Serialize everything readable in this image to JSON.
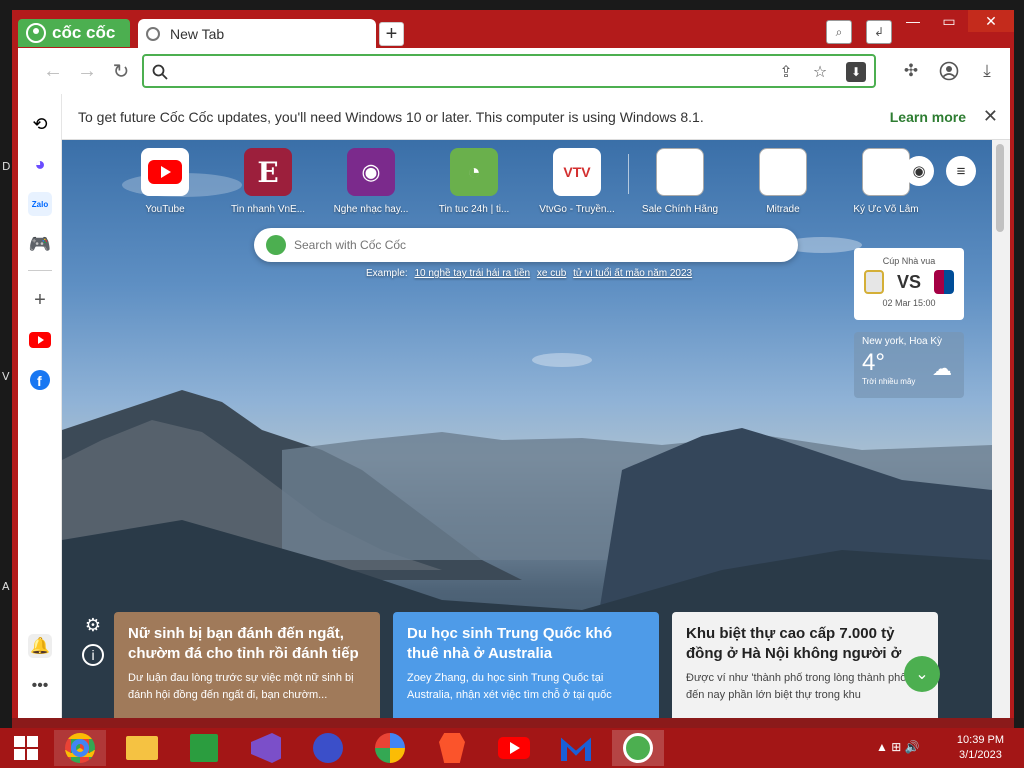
{
  "desktop": {
    "letters": [
      "D",
      "V",
      "A"
    ]
  },
  "browser": {
    "brand": "cốc cốc",
    "tab": {
      "title": "New Tab"
    },
    "newtab_symbol": "+",
    "omnibox": {
      "value": "",
      "placeholder": ""
    },
    "icons": {
      "back": "arrow-left-icon",
      "forward": "arrow-right-icon",
      "reload": "reload-icon",
      "search": "search-icon",
      "share": "share-icon",
      "star": "star-icon",
      "download_site": "download-square-icon",
      "extensions": "puzzle-icon",
      "profile": "profile-icon",
      "downloads": "download-icon"
    },
    "accent": "#4caf50"
  },
  "infobar": {
    "message": "To get future Cốc Cốc updates, you'll need Windows 10 or later. This computer is using Windows 8.1.",
    "learn_more": "Learn more",
    "close": "✕"
  },
  "sidebar": {
    "items": [
      {
        "name": "history-icon"
      },
      {
        "name": "messenger-icon"
      },
      {
        "name": "zalo-icon",
        "label": "Zalo"
      },
      {
        "name": "game-icon"
      },
      {
        "name": "add-icon"
      },
      {
        "name": "youtube-icon"
      },
      {
        "name": "facebook-icon"
      },
      {
        "name": "notification-bell-icon"
      },
      {
        "name": "more-icon"
      }
    ]
  },
  "new_tab": {
    "tiles": [
      {
        "label": "YouTube",
        "color": "#ffffff",
        "glyph": "▶"
      },
      {
        "label": "Tin nhanh VnE...",
        "color": "#9c1f3c",
        "glyph": "E"
      },
      {
        "label": "Nghe nhạc hay...",
        "color": "#7b2a8c",
        "glyph": "◉"
      },
      {
        "label": "Tin tuc 24h | ti...",
        "color": "#6ab04c",
        "glyph": "◔"
      },
      {
        "label": "VtvGo - Truyền...",
        "color": "#ffffff",
        "glyph": "VTV"
      },
      {
        "label": "Sale Chính Hãng",
        "color": "#ffffff",
        "glyph": ""
      },
      {
        "label": "Mitrade",
        "color": "#ffffff",
        "glyph": ""
      },
      {
        "label": "Ký Ức Võ Lâm",
        "color": "#ffffff",
        "glyph": ""
      }
    ],
    "search": {
      "placeholder": "Search with Cốc Cốc"
    },
    "example": {
      "prefix": "Example:",
      "links": [
        "10 nghề tay trái hái ra tiền",
        "xe cub",
        "tử vi tuổi ất mão năm 2023"
      ]
    },
    "match": {
      "competition": "Cúp Nhà vua",
      "vs": "VS",
      "date": "02 Mar 15:00"
    },
    "weather": {
      "city": "New york, Hoa Kỳ",
      "temp": "4°",
      "desc": "Trời nhiều mây"
    },
    "news": [
      {
        "title": "Nữ sinh bị bạn đánh đến ngất, chườm đá cho tỉnh rồi đánh tiếp",
        "snippet": "Dư luận đau lòng trước sự việc một nữ sinh bị đánh hội đồng đến ngất đi, bạn chườm...",
        "color": "#a07a5a"
      },
      {
        "title": "Du học sinh Trung Quốc khó thuê nhà ở Australia",
        "snippet": "Zoey Zhang, du học sinh Trung Quốc tại Australia, nhận xét việc tìm chỗ ở tại quốc",
        "color": "#4e9be8"
      },
      {
        "title": "Khu biệt thự cao cấp 7.000 tỷ đồng ở Hà Nội không người ở",
        "snippet": "Được ví như 'thành phố trong lòng thành phố', đến nay phần lớn biệt thự trong khu",
        "color": "#f2f2f2"
      }
    ]
  },
  "taskbar": {
    "apps": [
      {
        "name": "windows-start-icon"
      },
      {
        "name": "chrome-icon"
      },
      {
        "name": "file-explorer-icon"
      },
      {
        "name": "store-icon"
      },
      {
        "name": "visual-studio-icon"
      },
      {
        "name": "network-app-icon"
      },
      {
        "name": "browser-lock-icon"
      },
      {
        "name": "brave-icon"
      },
      {
        "name": "youtube-app-icon"
      },
      {
        "name": "malwarebytes-icon"
      },
      {
        "name": "coccoc-app-icon"
      }
    ],
    "tray": "▲  ⊞  🔊",
    "time": "10:39 PM",
    "date": "3/1/2023"
  }
}
